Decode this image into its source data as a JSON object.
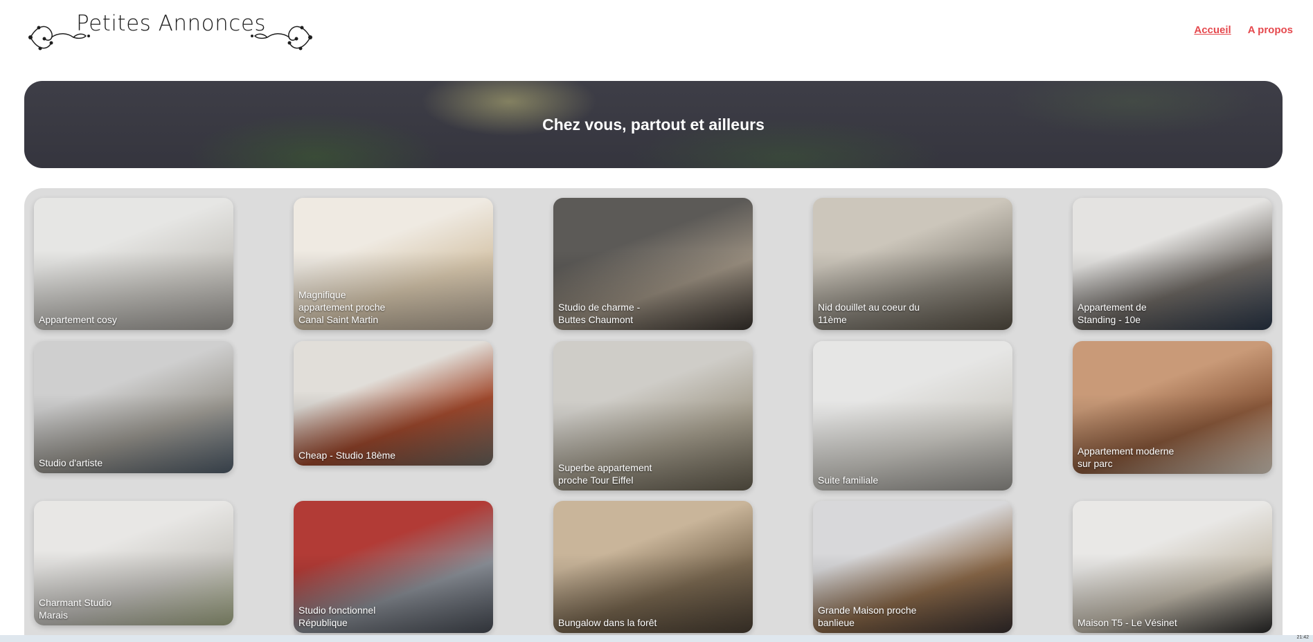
{
  "header": {
    "site_title": "Petites Annonces",
    "nav": [
      {
        "label": "Accueil",
        "active": true
      },
      {
        "label": "A propos",
        "active": false
      }
    ],
    "accent_color": "#e5484d"
  },
  "hero": {
    "title": "Chez vous, partout et ailleurs"
  },
  "listings": [
    {
      "title": "Appartement cosy",
      "palette": [
        "#e6e6e4",
        "#c9c7c2",
        "#a8a5a0"
      ]
    },
    {
      "title": "Magnifique appartement proche Canal Saint Martin",
      "palette": [
        "#efeae2",
        "#d7c7ad",
        "#b8ab9a"
      ]
    },
    {
      "title": "Studio de charme - Buttes Chaumont",
      "palette": [
        "#5c5a57",
        "#9a8f80",
        "#3b3530"
      ]
    },
    {
      "title": "Nid douillet au coeur du 11ème",
      "palette": [
        "#ccc6bb",
        "#8f8a80",
        "#5b5448"
      ]
    },
    {
      "title": "Appartement de Standing - 10e",
      "palette": [
        "#e4e3e1",
        "#6f6a65",
        "#2d3a4d"
      ]
    },
    {
      "title": "Studio d'artiste",
      "palette": [
        "#cfcfcf",
        "#9d9a93",
        "#52606e"
      ]
    },
    {
      "title": "Cheap - Studio 18ème",
      "palette": [
        "#e1ded9",
        "#a14a2e",
        "#6f6a63"
      ]
    },
    {
      "title": "Superbe appartement proche Tour Eiffel",
      "palette": [
        "#cfcdc8",
        "#a29b8b",
        "#6a6353"
      ]
    },
    {
      "title": "Suite familiale",
      "palette": [
        "#e6e6e5",
        "#cfcdc7",
        "#9e9c97"
      ]
    },
    {
      "title": "Appartement moderne sur parc",
      "palette": [
        "#c99a78",
        "#8c5a3c",
        "#e0d6c8"
      ]
    },
    {
      "title": "Charmant Studio Marais",
      "palette": [
        "#e8e7e5",
        "#cbc9c4",
        "#a9b08a"
      ]
    },
    {
      "title": "Studio fonctionnel République",
      "palette": [
        "#b23b36",
        "#8a8f97",
        "#4a4f58"
      ]
    },
    {
      "title": "Bungalow dans la forêt",
      "palette": [
        "#c9b59a",
        "#7c6a52",
        "#4d4236"
      ]
    },
    {
      "title": "Grande Maison proche banlieue",
      "palette": [
        "#d8d8da",
        "#8c6a4a",
        "#3a3232"
      ]
    },
    {
      "title": "Maison T5 - Le Vésinet",
      "palette": [
        "#e9e8e6",
        "#c7bfb0",
        "#2b2b2b"
      ]
    }
  ],
  "taskbar": {
    "time": "21:42"
  }
}
